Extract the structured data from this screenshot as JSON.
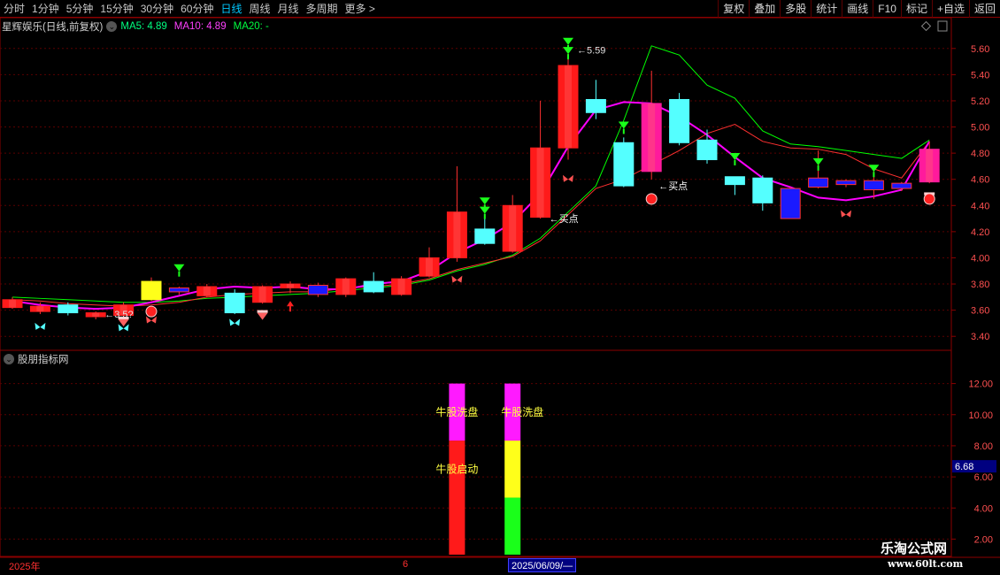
{
  "toolbar": {
    "periods": [
      "分时",
      "1分钟",
      "5分钟",
      "15分钟",
      "30分钟",
      "60分钟",
      "日线",
      "周线",
      "月线",
      "多周期",
      "更多"
    ],
    "active_period": "日线",
    "more_arrow": ">",
    "buttons": [
      "复权",
      "叠加",
      "多股",
      "统计",
      "画线",
      "F10",
      "标记",
      "+自选",
      "返回"
    ]
  },
  "main_panel": {
    "stock_title": "星辉娱乐(日线,前复权)",
    "ma5_label": "MA5: 4.89",
    "ma10_label": "MA10: 4.89",
    "ma20_label": "MA20: -",
    "annotations": {
      "low_label": "←3.5?",
      "high_label": "←5.59",
      "buy_label_1": "←买点",
      "buy_label_2": "←买点"
    }
  },
  "sub_panel": {
    "title": "股朋指标网",
    "current_value": "6.68",
    "bar_label_wash_1": "牛股洗盘",
    "bar_label_start": "牛股启动",
    "bar_label_wash_2": "牛股洗盘"
  },
  "date_axis": {
    "year_label": "2025年",
    "month_label": "6",
    "cursor_date": "2025/06/09/—"
  },
  "watermark": {
    "brand": "乐淘公式网",
    "url": "www.60lt.com"
  },
  "colors": {
    "up": "#ff1a1a",
    "down": "#54ffff",
    "ma5": "#ff00ff",
    "ma10": "#ff3030",
    "ma20": "#00ff00",
    "axis_border": "#8b0000",
    "price_label": "#ff5050"
  },
  "chart_data": [
    {
      "type": "candlestick",
      "title": "星辉娱乐(日线,前复权)",
      "ylim": [
        3.3,
        5.7
      ],
      "y_ticks": [
        3.4,
        3.6,
        3.8,
        4.0,
        4.2,
        4.4,
        4.6,
        4.8,
        5.0,
        5.2,
        5.4,
        5.6
      ],
      "candles": [
        {
          "open": 3.68,
          "close": 3.62,
          "high": 3.7,
          "low": 3.61,
          "color": "red"
        },
        {
          "open": 3.63,
          "close": 3.59,
          "high": 3.66,
          "low": 3.57,
          "color": "red"
        },
        {
          "open": 3.64,
          "close": 3.58,
          "high": 3.66,
          "low": 3.56,
          "color": "cyan"
        },
        {
          "open": 3.55,
          "close": 3.58,
          "high": 3.59,
          "low": 3.53,
          "color": "red"
        },
        {
          "open": 3.56,
          "close": 3.64,
          "high": 3.66,
          "low": 3.54,
          "color": "red"
        },
        {
          "open": 3.68,
          "close": 3.82,
          "high": 3.85,
          "low": 3.67,
          "color": "yellow"
        },
        {
          "open": 3.77,
          "close": 3.74,
          "high": 3.78,
          "low": 3.72,
          "color": "blue"
        },
        {
          "open": 3.71,
          "close": 3.78,
          "high": 3.8,
          "low": 3.7,
          "color": "red"
        },
        {
          "open": 3.73,
          "close": 3.58,
          "high": 3.76,
          "low": 3.57,
          "color": "cyan"
        },
        {
          "open": 3.66,
          "close": 3.78,
          "high": 3.79,
          "low": 3.65,
          "color": "red"
        },
        {
          "open": 3.77,
          "close": 3.8,
          "high": 3.82,
          "low": 3.73,
          "color": "red"
        },
        {
          "open": 3.79,
          "close": 3.72,
          "high": 3.81,
          "low": 3.7,
          "color": "blue"
        },
        {
          "open": 3.72,
          "close": 3.84,
          "high": 3.85,
          "low": 3.7,
          "color": "red"
        },
        {
          "open": 3.82,
          "close": 3.74,
          "high": 3.89,
          "low": 3.73,
          "color": "cyan"
        },
        {
          "open": 3.72,
          "close": 3.84,
          "high": 3.86,
          "low": 3.71,
          "color": "red"
        },
        {
          "open": 3.86,
          "close": 4.0,
          "high": 4.08,
          "low": 3.85,
          "color": "red"
        },
        {
          "open": 4.0,
          "close": 4.35,
          "high": 4.7,
          "low": 3.97,
          "color": "red"
        },
        {
          "open": 4.22,
          "close": 4.11,
          "high": 4.32,
          "low": 4.1,
          "color": "cyan"
        },
        {
          "open": 4.05,
          "close": 4.4,
          "high": 4.48,
          "low": 4.04,
          "color": "red"
        },
        {
          "open": 4.31,
          "close": 4.84,
          "high": 5.2,
          "low": 4.3,
          "color": "red"
        },
        {
          "open": 4.84,
          "close": 5.47,
          "high": 5.6,
          "low": 4.75,
          "color": "red"
        },
        {
          "open": 5.21,
          "close": 5.11,
          "high": 5.36,
          "low": 5.06,
          "color": "cyan"
        },
        {
          "open": 4.88,
          "close": 4.55,
          "high": 4.92,
          "low": 4.54,
          "color": "cyan"
        },
        {
          "open": 4.66,
          "close": 5.18,
          "high": 5.43,
          "low": 4.6,
          "color": "magenta"
        },
        {
          "open": 5.21,
          "close": 4.88,
          "high": 5.26,
          "low": 4.86,
          "color": "cyan"
        },
        {
          "open": 4.9,
          "close": 4.75,
          "high": 4.98,
          "low": 4.72,
          "color": "cyan"
        },
        {
          "open": 4.62,
          "close": 4.56,
          "high": 4.62,
          "low": 4.48,
          "color": "cyan"
        },
        {
          "open": 4.61,
          "close": 4.42,
          "high": 4.63,
          "low": 4.36,
          "color": "cyan"
        },
        {
          "open": 4.53,
          "close": 4.3,
          "high": 4.54,
          "low": 4.3,
          "color": "blue"
        },
        {
          "open": 4.61,
          "close": 4.54,
          "high": 4.82,
          "low": 4.53,
          "color": "blue"
        },
        {
          "open": 4.59,
          "close": 4.56,
          "high": 4.6,
          "low": 4.54,
          "color": "blue"
        },
        {
          "open": 4.59,
          "close": 4.52,
          "high": 4.67,
          "low": 4.45,
          "color": "blue"
        },
        {
          "open": 4.57,
          "close": 4.53,
          "high": 4.58,
          "low": 4.51,
          "color": "blue"
        },
        {
          "open": 4.58,
          "close": 4.83,
          "high": 4.89,
          "low": 4.57,
          "color": "magenta"
        }
      ],
      "series": [
        {
          "name": "MA5",
          "values": [
            3.67,
            3.64,
            3.62,
            3.61,
            3.62,
            3.66,
            3.71,
            3.76,
            3.78,
            3.77,
            3.78,
            3.76,
            3.76,
            3.8,
            3.82,
            3.9,
            4.04,
            4.14,
            4.27,
            4.49,
            4.85,
            5.13,
            5.19,
            5.18,
            5.08,
            4.94,
            4.77,
            4.61,
            4.54,
            4.46,
            4.44,
            4.47,
            4.52,
            4.89
          ]
        },
        {
          "name": "MA10",
          "values": [
            3.68,
            3.67,
            3.65,
            3.64,
            3.63,
            3.64,
            3.66,
            3.7,
            3.72,
            3.73,
            3.74,
            3.74,
            3.77,
            3.78,
            3.8,
            3.84,
            3.91,
            3.96,
            4.01,
            4.13,
            4.33,
            4.53,
            4.6,
            4.71,
            4.82,
            4.95,
            5.02,
            4.89,
            4.84,
            4.83,
            4.79,
            4.68,
            4.61,
            4.89
          ]
        },
        {
          "name": "MA20",
          "values": [
            3.7,
            3.69,
            3.68,
            3.67,
            3.66,
            3.66,
            3.67,
            3.69,
            3.7,
            3.71,
            3.72,
            3.73,
            3.75,
            3.77,
            3.79,
            3.83,
            3.9,
            3.95,
            4.02,
            4.15,
            4.35,
            4.55,
            5.05,
            5.62,
            5.55,
            5.32,
            5.22,
            4.97,
            4.87,
            4.85,
            4.82,
            4.79,
            4.76,
            4.9
          ]
        }
      ],
      "annotations": [
        {
          "text": "←3.5?",
          "value": 3.57
        },
        {
          "text": "←5.59",
          "value": 5.59
        },
        {
          "text": "←买点",
          "value": 4.3
        },
        {
          "text": "←买点",
          "value": 4.55
        }
      ]
    },
    {
      "type": "bar",
      "title": "股朋指标网",
      "ylim": [
        1.0,
        13.0
      ],
      "y_ticks": [
        2.0,
        4.0,
        6.0,
        8.0,
        10.0,
        12.0
      ],
      "current_value": 6.68,
      "bars": [
        {
          "index": 16,
          "segments": [
            {
              "from": 0,
              "to": 8,
              "color": "#ff1a1a",
              "label": "牛股启动"
            },
            {
              "from": 8,
              "to": 12,
              "color": "#ff1aff",
              "label": "牛股洗盘"
            }
          ]
        },
        {
          "index": 18,
          "segments": [
            {
              "from": 0,
              "to": 4,
              "color": "#1aff1a",
              "label": ""
            },
            {
              "from": 4,
              "to": 8,
              "color": "#ffff1a",
              "label": ""
            },
            {
              "from": 8,
              "to": 12,
              "color": "#ff1aff",
              "label": "牛股洗盘"
            }
          ]
        }
      ]
    }
  ]
}
